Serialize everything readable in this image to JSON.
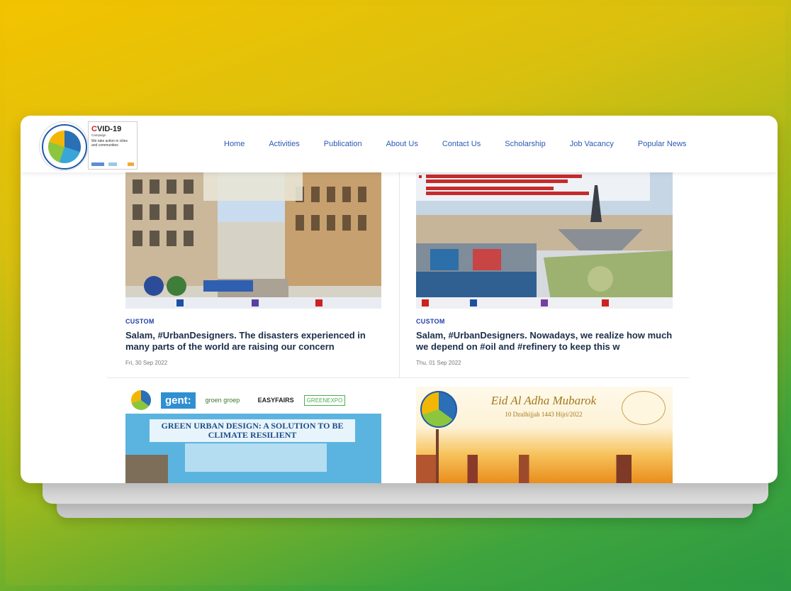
{
  "brand": {
    "logo_alt": "Asia-Pacific Urban Designers",
    "covid_badge": {
      "title_c": "C",
      "title_rest": "VID-19",
      "subtitle": "Campaign",
      "text": "We take action in cities and communities"
    }
  },
  "nav": {
    "items": [
      {
        "label": "Home"
      },
      {
        "label": "Activities"
      },
      {
        "label": "Publication"
      },
      {
        "label": "About Us"
      },
      {
        "label": "Contact Us"
      },
      {
        "label": "Scholarship"
      },
      {
        "label": "Job Vacancy"
      },
      {
        "label": "Popular News"
      }
    ]
  },
  "posts": [
    {
      "tag": "CUSTOM",
      "title": "Salam, #UrbanDesigners. The disasters experienced in many parts of the world are raising our concern",
      "date": "Fri, 30 Sep 2022"
    },
    {
      "tag": "CUSTOM",
      "title": "Salam, #UrbanDesigners. Nowadays, we realize how much we depend on #oil and #refinery to keep this w",
      "date": "Thu, 01 Sep 2022"
    },
    {
      "image_heading": "GREEN URBAN DESIGN: A SOLUTION TO BE CLIMATE RESILIENT",
      "logos": [
        "gent:",
        "groen groep",
        "EASYFAIRS",
        "GREENEXPO"
      ]
    },
    {
      "image_heading": "Eid Al Adha Mubarok",
      "image_sub": "10 Dzulhijjah 1443 Hijri/2022"
    }
  ],
  "colors": {
    "nav_link": "#2c57b6",
    "tag": "#1f3fa8",
    "title": "#1b2e4a"
  }
}
